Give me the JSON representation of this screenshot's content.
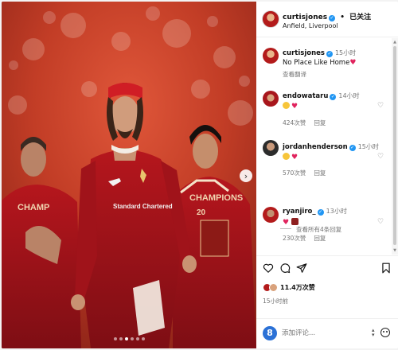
{
  "header": {
    "username": "curtisjones",
    "separator": "•",
    "follow_status": "已关注",
    "location": "Anfield, Liverpool"
  },
  "caption": {
    "username": "curtisjones",
    "time": "15小时",
    "text": "No Place Like Home",
    "translate": "查看翻译"
  },
  "comments": [
    {
      "username": "endowataru",
      "time": "14小时",
      "likes": "424次赞",
      "reply": "回复"
    },
    {
      "username": "jordanhenderson",
      "time": "15小时",
      "likes": "570次赞",
      "reply": "回复"
    },
    {
      "username": "ryanjiro_",
      "time": "13小时",
      "likes": "230次赞",
      "reply": "回复"
    }
  ],
  "more_replies": "查看所有4条回复",
  "actions": {
    "likes": "11.4万次赞",
    "post_time": "15小时前"
  },
  "comment_box": {
    "avatar_letter": "8",
    "placeholder": "添加评论..."
  },
  "photo": {
    "jersey_sponsor": "Standard Chartered",
    "shirt_text_left": "CHAMP",
    "shirt_text_right": "CHAMPIONS",
    "shirt_sub": "20"
  },
  "colors": {
    "verified": "#2196f3",
    "heart": "#e0245e",
    "liverpool_red": "#b31b1b"
  },
  "icons": {
    "like": "heart-outline-icon",
    "comment": "comment-bubble-icon",
    "share": "paper-plane-icon",
    "save": "bookmark-icon",
    "emoji": "emoji-icon"
  }
}
